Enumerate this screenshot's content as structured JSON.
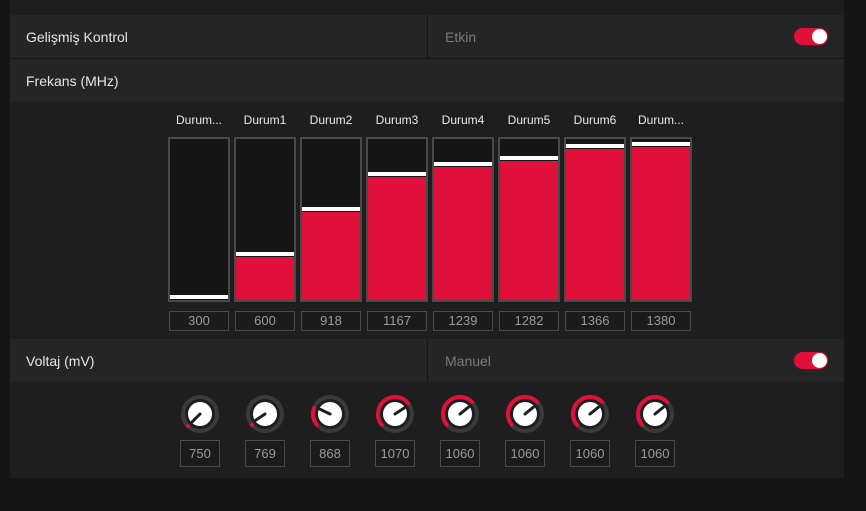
{
  "advanced_control": {
    "label": "Gelişmiş Kontrol",
    "state_label": "Etkin",
    "enabled": true
  },
  "frequency": {
    "label": "Frekans (MHz)",
    "min": 300,
    "max": 1380,
    "states": [
      {
        "label": "Durum...",
        "value": 300
      },
      {
        "label": "Durum1",
        "value": 600
      },
      {
        "label": "Durum2",
        "value": 918
      },
      {
        "label": "Durum3",
        "value": 1167
      },
      {
        "label": "Durum4",
        "value": 1239
      },
      {
        "label": "Durum5",
        "value": 1282
      },
      {
        "label": "Durum6",
        "value": 1366
      },
      {
        "label": "Durum...",
        "value": 1380
      }
    ]
  },
  "voltage": {
    "label": "Voltaj (mV)",
    "mode_label": "Manuel",
    "enabled": true,
    "min": 750,
    "max": 1200,
    "states": [
      {
        "value": 750
      },
      {
        "value": 769
      },
      {
        "value": 868
      },
      {
        "value": 1070
      },
      {
        "value": 1060
      },
      {
        "value": 1060
      },
      {
        "value": 1060
      },
      {
        "value": 1060
      }
    ]
  },
  "colors": {
    "accent": "#e0103a",
    "track": "#3a3a3a",
    "knob": "#ffffff"
  }
}
